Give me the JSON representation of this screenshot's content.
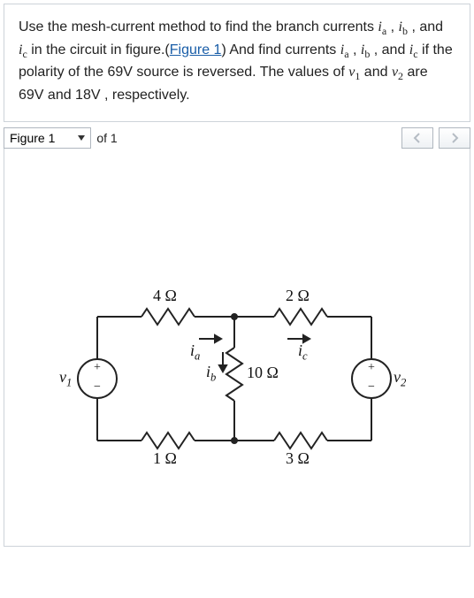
{
  "problem": {
    "text_1": "Use the mesh-current method to find the branch currents ",
    "var_ia": "i",
    "sub_a": "a",
    "comma1": " , ",
    "var_ib": "i",
    "sub_b": "b",
    "comma2": " , and ",
    "var_ic": "i",
    "sub_c": "c",
    "text_2": " in the circuit in figure.(",
    "figure_link": "Figure 1",
    "text_3": ") And find currents ",
    "text_4": " if the polarity of the 69V source is reversed. The values of ",
    "var_v1": "v",
    "sub_1": "1",
    "and": " and ",
    "var_v2": "v",
    "sub_2": "2",
    "text_5": " are 69V and 18V , respectively."
  },
  "toolbar": {
    "figure_label": "Figure 1",
    "of_label": "of 1"
  },
  "circuit": {
    "r_top_left": "4 Ω",
    "r_top_right": "2 Ω",
    "r_mid": "10 Ω",
    "r_bot_left": "1 Ω",
    "r_bot_right": "3 Ω",
    "ia": "i",
    "ia_sub": "a",
    "ib": "i",
    "ib_sub": "b",
    "ic": "i",
    "ic_sub": "c",
    "v1": "v",
    "v1_sub": "1",
    "v2": "v",
    "v2_sub": "2",
    "plus": "+",
    "minus": "−"
  }
}
